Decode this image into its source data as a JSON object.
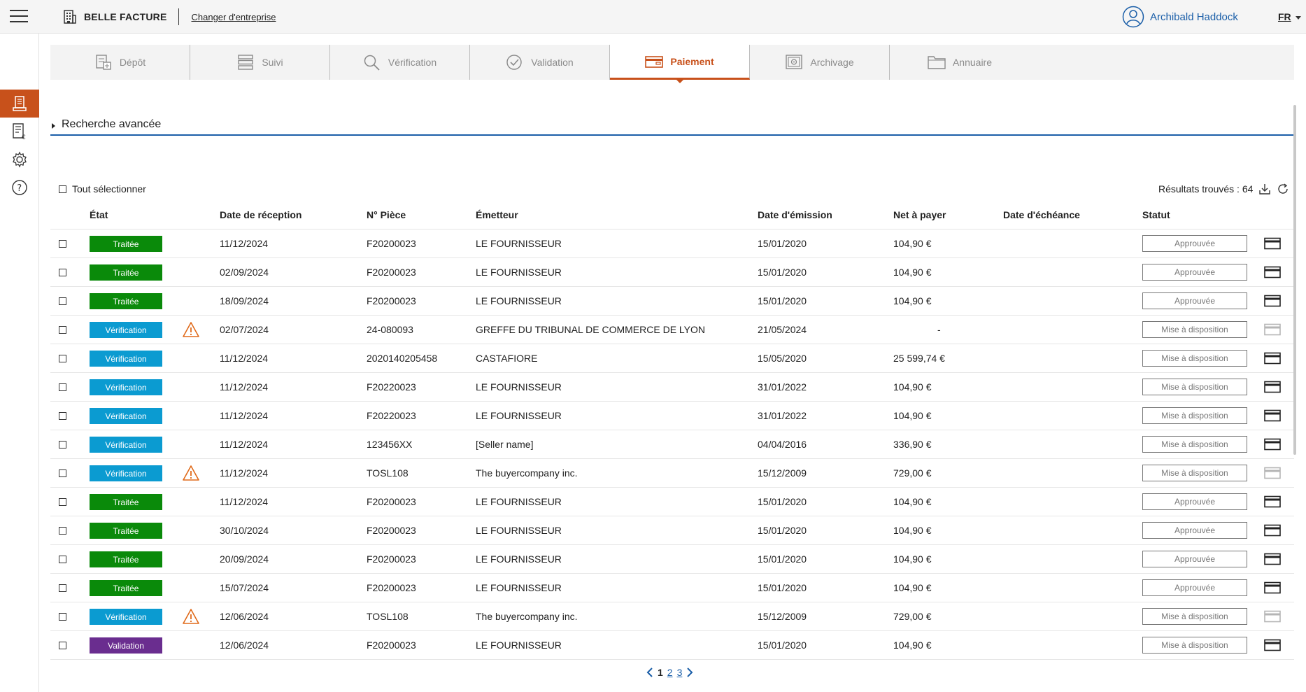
{
  "header": {
    "brand": "BELLE FACTURE",
    "change_company": "Changer d'entreprise",
    "user_name": "Archibald Haddock",
    "lang": "FR"
  },
  "sidebar": {
    "items": [
      {
        "icon": "invoice-icon",
        "active": true
      },
      {
        "icon": "invoice-euro-icon",
        "active": false
      },
      {
        "icon": "gear-icon",
        "active": false
      },
      {
        "icon": "help-icon",
        "active": false
      }
    ]
  },
  "tabs": [
    {
      "label": "Dépôt",
      "icon": "deposit-icon",
      "active": false
    },
    {
      "label": "Suivi",
      "icon": "list-icon",
      "active": false
    },
    {
      "label": "Vérification",
      "icon": "search-icon",
      "active": false
    },
    {
      "label": "Validation",
      "icon": "check-circle-icon",
      "active": false
    },
    {
      "label": "Paiement",
      "icon": "wallet-icon",
      "active": true
    },
    {
      "label": "Archivage",
      "icon": "safe-icon",
      "active": false
    },
    {
      "label": "Annuaire",
      "icon": "folder-icon",
      "active": false
    }
  ],
  "advanced_search": "Recherche avancée",
  "select_all": "Tout sélectionner",
  "results": "Résultats trouvés : 64",
  "columns": {
    "etat": "État",
    "date_reception": "Date de réception",
    "piece": "N° Pièce",
    "emetteur": "Émetteur",
    "date_emission": "Date d'émission",
    "net": "Net à payer",
    "echeance": "Date d'échéance",
    "statut": "Statut"
  },
  "colors": {
    "accent": "#c8511b",
    "link": "#1a5ea8",
    "traitee": "#0a8a0a",
    "verification": "#0b9bd1",
    "validation": "#6a2d8f"
  },
  "rows": [
    {
      "etat": "Traitée",
      "kind": "traitee",
      "warn": false,
      "date_reception": "11/12/2024",
      "piece": "F20200023",
      "emetteur": "LE FOURNISSEUR",
      "date_emission": "15/01/2020",
      "net": "104,90 €",
      "echeance": "",
      "statut": "Approuvée",
      "card_enabled": true
    },
    {
      "etat": "Traitée",
      "kind": "traitee",
      "warn": false,
      "date_reception": "02/09/2024",
      "piece": "F20200023",
      "emetteur": "LE FOURNISSEUR",
      "date_emission": "15/01/2020",
      "net": "104,90 €",
      "echeance": "",
      "statut": "Approuvée",
      "card_enabled": true
    },
    {
      "etat": "Traitée",
      "kind": "traitee",
      "warn": false,
      "date_reception": "18/09/2024",
      "piece": "F20200023",
      "emetteur": "LE FOURNISSEUR",
      "date_emission": "15/01/2020",
      "net": "104,90 €",
      "echeance": "",
      "statut": "Approuvée",
      "card_enabled": true
    },
    {
      "etat": "Vérification",
      "kind": "verification",
      "warn": true,
      "date_reception": "02/07/2024",
      "piece": "24-080093",
      "emetteur": "GREFFE DU TRIBUNAL DE COMMERCE DE LYON",
      "date_emission": "21/05/2024",
      "net": "-",
      "echeance": "",
      "statut": "Mise à disposition",
      "card_enabled": false
    },
    {
      "etat": "Vérification",
      "kind": "verification",
      "warn": false,
      "date_reception": "11/12/2024",
      "piece": "2020140205458",
      "emetteur": "CASTAFIORE",
      "date_emission": "15/05/2020",
      "net": "25 599,74 €",
      "echeance": "",
      "statut": "Mise à disposition",
      "card_enabled": true
    },
    {
      "etat": "Vérification",
      "kind": "verification",
      "warn": false,
      "date_reception": "11/12/2024",
      "piece": "F20220023",
      "emetteur": "LE FOURNISSEUR",
      "date_emission": "31/01/2022",
      "net": "104,90 €",
      "echeance": "",
      "statut": "Mise à disposition",
      "card_enabled": true
    },
    {
      "etat": "Vérification",
      "kind": "verification",
      "warn": false,
      "date_reception": "11/12/2024",
      "piece": "F20220023",
      "emetteur": "LE FOURNISSEUR",
      "date_emission": "31/01/2022",
      "net": "104,90 €",
      "echeance": "",
      "statut": "Mise à disposition",
      "card_enabled": true
    },
    {
      "etat": "Vérification",
      "kind": "verification",
      "warn": false,
      "date_reception": "11/12/2024",
      "piece": "123456XX",
      "emetteur": "[Seller name]",
      "date_emission": "04/04/2016",
      "net": "336,90 €",
      "echeance": "",
      "statut": "Mise à disposition",
      "card_enabled": true
    },
    {
      "etat": "Vérification",
      "kind": "verification",
      "warn": true,
      "date_reception": "11/12/2024",
      "piece": "TOSL108",
      "emetteur": "The buyercompany inc.",
      "date_emission": "15/12/2009",
      "net": "729,00 €",
      "echeance": "",
      "statut": "Mise à disposition",
      "card_enabled": false
    },
    {
      "etat": "Traitée",
      "kind": "traitee",
      "warn": false,
      "date_reception": "11/12/2024",
      "piece": "F20200023",
      "emetteur": "LE FOURNISSEUR",
      "date_emission": "15/01/2020",
      "net": "104,90 €",
      "echeance": "",
      "statut": "Approuvée",
      "card_enabled": true
    },
    {
      "etat": "Traitée",
      "kind": "traitee",
      "warn": false,
      "date_reception": "30/10/2024",
      "piece": "F20200023",
      "emetteur": "LE FOURNISSEUR",
      "date_emission": "15/01/2020",
      "net": "104,90 €",
      "echeance": "",
      "statut": "Approuvée",
      "card_enabled": true
    },
    {
      "etat": "Traitée",
      "kind": "traitee",
      "warn": false,
      "date_reception": "20/09/2024",
      "piece": "F20200023",
      "emetteur": "LE FOURNISSEUR",
      "date_emission": "15/01/2020",
      "net": "104,90 €",
      "echeance": "",
      "statut": "Approuvée",
      "card_enabled": true
    },
    {
      "etat": "Traitée",
      "kind": "traitee",
      "warn": false,
      "date_reception": "15/07/2024",
      "piece": "F20200023",
      "emetteur": "LE FOURNISSEUR",
      "date_emission": "15/01/2020",
      "net": "104,90 €",
      "echeance": "",
      "statut": "Approuvée",
      "card_enabled": true
    },
    {
      "etat": "Vérification",
      "kind": "verification",
      "warn": true,
      "date_reception": "12/06/2024",
      "piece": "TOSL108",
      "emetteur": "The buyercompany inc.",
      "date_emission": "15/12/2009",
      "net": "729,00 €",
      "echeance": "",
      "statut": "Mise à disposition",
      "card_enabled": false
    },
    {
      "etat": "Validation",
      "kind": "validation",
      "warn": false,
      "date_reception": "12/06/2024",
      "piece": "F20200023",
      "emetteur": "LE FOURNISSEUR",
      "date_emission": "15/01/2020",
      "net": "104,90 €",
      "echeance": "",
      "statut": "Mise à disposition",
      "card_enabled": true
    }
  ],
  "pagination": {
    "current": "1",
    "pages": [
      "2",
      "3"
    ]
  }
}
